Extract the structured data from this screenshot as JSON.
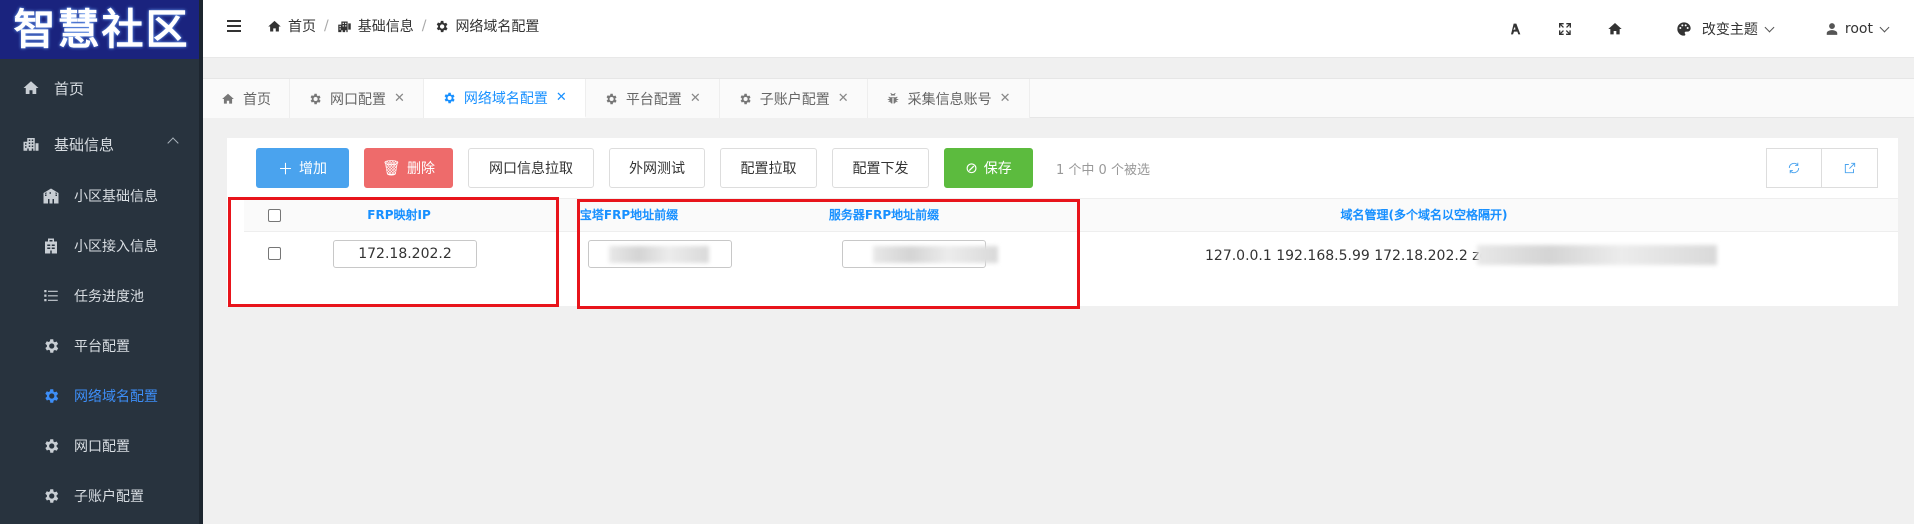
{
  "sidebar": {
    "logo_text": "智慧社区",
    "items": [
      {
        "label": "首页",
        "icon": "home-icon"
      },
      {
        "label": "基础信息",
        "icon": "building-icon"
      },
      {
        "label": "小区基础信息",
        "icon": "community-icon"
      },
      {
        "label": "小区接入信息",
        "icon": "access-icon"
      },
      {
        "label": "任务进度池",
        "icon": "task-list-icon"
      },
      {
        "label": "平台配置",
        "icon": "gear-icon"
      },
      {
        "label": "网络域名配置",
        "icon": "gear-icon",
        "active": true
      },
      {
        "label": "网口配置",
        "icon": "gear-icon"
      },
      {
        "label": "子账户配置",
        "icon": "gear-icon"
      }
    ]
  },
  "header": {
    "breadcrumb": [
      "首页",
      "基础信息",
      "网络域名配置"
    ],
    "theme_label": "改变主题",
    "user_label": "root"
  },
  "tabs": [
    {
      "label": "首页",
      "icon": "home-icon",
      "closable": false
    },
    {
      "label": "网口配置",
      "icon": "gear-icon",
      "closable": true
    },
    {
      "label": "网络域名配置",
      "icon": "gear-icon",
      "closable": true,
      "active": true
    },
    {
      "label": "平台配置",
      "icon": "gear-icon",
      "closable": true
    },
    {
      "label": "子账户配置",
      "icon": "gear-icon",
      "closable": true
    },
    {
      "label": "采集信息账号",
      "icon": "bug-icon",
      "closable": true
    }
  ],
  "toolbar": {
    "add": "增加",
    "delete": "删除",
    "pull_port": "网口信息拉取",
    "ext_test": "外网测试",
    "pull_config": "配置拉取",
    "push_config": "配置下发",
    "save": "保存",
    "selection_info": "1 个中 0 个被选"
  },
  "table": {
    "headers": {
      "frp_ip": "FRP映射IP",
      "bt_prefix": "宝塔FRP地址前缀",
      "server_prefix": "服务器FRP地址前缀",
      "domain": "域名管理(多个域名以空格隔开)"
    },
    "rows": [
      {
        "frp_ip": "172.18.202.2",
        "domain": "127.0.0.1 192.168.5.99 172.18.202.2 zc"
      }
    ]
  },
  "colors": {
    "sidebar_bg": "#28333e",
    "accent": "#1890ff",
    "annotation_red": "#e8141b"
  }
}
